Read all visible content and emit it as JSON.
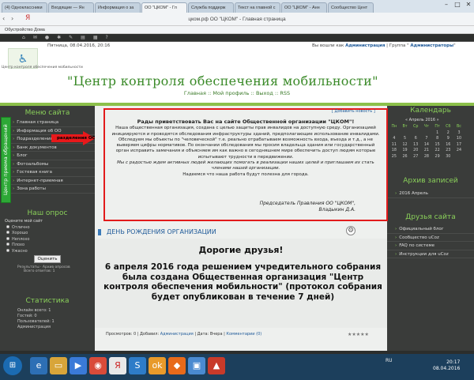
{
  "browser": {
    "tabs": [
      "(4) Одноклассники",
      "Входящие — Ян",
      "Информация о за",
      "ОО \"ЦКОМ\" - Гл",
      "Служба поддерж",
      "Текст на главной с",
      "ОО \"ЦКОМ\" - Анн",
      "Сообщество Цент"
    ],
    "address": "цком.рф  ОО \"ЦКОМ\" - Главная страница",
    "bookmark": "Обустройство Дома"
  },
  "header": {
    "date": "Пятница, 08.04.2016, 20:16",
    "login_prefix": "Вы вошли как",
    "login_user": "Администрация",
    "group_prefix": " | Группа \"",
    "group": "Администраторы",
    "logo_caption": "Центр контроля обеспечения мобильности",
    "site_title": "\"Центр контроля обеспечения мобильности\"",
    "nav": "Главная :: Мой профиль :: Выход :: RSS"
  },
  "left": {
    "menu_title": "Меню сайта",
    "menu": [
      "Главная страница",
      "Информация об ОО",
      "Подразделения ОО",
      "Банк документов",
      "Блог",
      "Фотоальбомы",
      "Гостевая книга",
      "Интернет-приемная",
      "Зона работы"
    ],
    "side_tab": "Центр приема обращений",
    "arrow_label": "разделения ОО",
    "poll_title": "Наш опрос",
    "poll_question": "Оцените мой сайт",
    "poll_options": [
      "Отлично",
      "Хорошо",
      "Неплохо",
      "Плохо",
      "Ужасно"
    ],
    "vote": "Оценить",
    "poll_results": "Результаты · Архив опросов",
    "poll_total": "Всего ответов: 1",
    "stats_title": "Статистика",
    "stats": [
      "Онлайн всего: 1",
      "Гостей: 0",
      "Пользователей: 1",
      "Администрация"
    ]
  },
  "right": {
    "calendar_title": "Календарь",
    "month": "« Апрель 2016 »",
    "weekdays": [
      "Пн",
      "Вт",
      "Ср",
      "Чт",
      "Пт",
      "Сб",
      "Вс"
    ],
    "weeks": [
      [
        "",
        "",
        "",
        "",
        "1",
        "2",
        "3"
      ],
      [
        "4",
        "5",
        "6",
        "7",
        "8",
        "9",
        "10"
      ],
      [
        "11",
        "12",
        "13",
        "14",
        "15",
        "16",
        "17"
      ],
      [
        "18",
        "19",
        "20",
        "21",
        "22",
        "23",
        "24"
      ],
      [
        "25",
        "26",
        "27",
        "28",
        "29",
        "30",
        ""
      ]
    ],
    "archive_title": "Архив записей",
    "archive": [
      "2016 Апрель"
    ],
    "friends_title": "Друзья сайта",
    "friends": [
      "Официальный блог",
      "Сообщество uCoz",
      "FAQ по системе",
      "Инструкции для uCoz"
    ]
  },
  "welcome": {
    "add_news": "[ Добавить новость ]",
    "heading": "Рады приветствовать Вас на сайте Общественной организации \"ЦКОМ\"!",
    "p1": "Наша общественная организация, создана с целью защиты прав инвалидов на доступную среду. Организацией инициируются и проводятся обследования инфраструктуры зданий, предполагающие использование инвалидами. Обследуем мы объекты по \"человеческой\" т.е. реально отрабатываем возможность входа, въезда и т.д., а не выверяем цифры нормативов. По окончании обследования мы просим владельца здания или государственный орган исправить замечания и объясняем им как важно в сегодняшнем мире обеспечить доступ людям которые испытывают трудности в передвижении.",
    "p2": "Мы с радостью ждем активных людей желающих помогать в реализации наших целей и приглашаем их стать членами нашей организации.",
    "p3": "Надеемся что наша работа будут полезна для города.",
    "signature1": "Председатель Правления ОО \"ЦКОМ\",",
    "signature2": "Владыкин Д.А."
  },
  "news": {
    "title": "ДЕНЬ РОЖДЕНИЯ ОРГАНИЗАЦИИ",
    "greeting": "Дорогие друзья!",
    "text": "6 апреля 2016 года решением учредительного собрания была создана Общественная организация \"Центр контроля обеспечения мобильности\" (протокол собрания будет опубликован в течение 7 дней)",
    "footer_views": "Просмотров: 0 | Добавил: ",
    "footer_author": "Администрация",
    "footer_date": " | Дата: Вчера | ",
    "footer_comments": "Комментарии (0)"
  },
  "taskbar": {
    "lang": "RU",
    "time": "20:17",
    "date": "08.04.2016"
  }
}
